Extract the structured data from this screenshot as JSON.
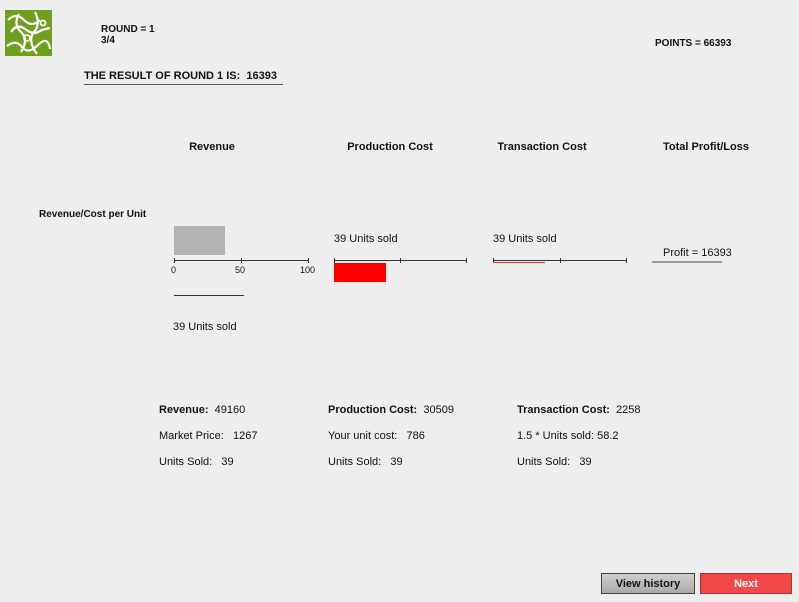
{
  "header": {
    "round_label": "ROUND = 1",
    "progress": "3/4",
    "points": "POINTS = 66393",
    "result_title": "THE RESULT OF ROUND 1 IS:",
    "result_value": "16393"
  },
  "columns": {
    "revenue": "Revenue",
    "production": "Production Cost",
    "transaction": "Transaction Cost",
    "profit": "Total Profit/Loss"
  },
  "row_label": "Revenue/Cost per Unit",
  "revenue_chart": {
    "units_sold_label": "39 Units sold",
    "ticks": [
      "0",
      "50",
      "100"
    ],
    "units_fraction": 0.39
  },
  "production_chart": {
    "units_sold_label": "39 Units sold",
    "units_fraction": 0.39
  },
  "transaction_chart": {
    "units_sold_label": "39 Units sold",
    "units_fraction": 0.39
  },
  "profit_chart": {
    "label": "Profit = 16393"
  },
  "summary": {
    "revenue_label": "Revenue:",
    "revenue_value": "49160",
    "market_price_label": "Market Price:",
    "market_price_value": "1267",
    "rev_units_label": "Units Sold:",
    "rev_units_value": "39",
    "production_label": "Production Cost:",
    "production_value": "30509",
    "unit_cost_label": "Your unit cost:",
    "unit_cost_value": "786",
    "prod_units_label": "Units Sold:",
    "prod_units_value": "39",
    "transaction_label": "Transaction Cost:",
    "transaction_value": "2258",
    "formula_label": "1.5 * Units sold:",
    "formula_value": "58.2",
    "trans_units_label": "Units Sold:",
    "trans_units_value": "39"
  },
  "buttons": {
    "view_history": "View history",
    "next": "Next"
  },
  "colors": {
    "logo": "#6f9f1e",
    "revenue_bar": "#b3b3b3",
    "production_bar": "#ff0000",
    "transaction_line": "#ff3333",
    "next_button": "#f44848"
  }
}
